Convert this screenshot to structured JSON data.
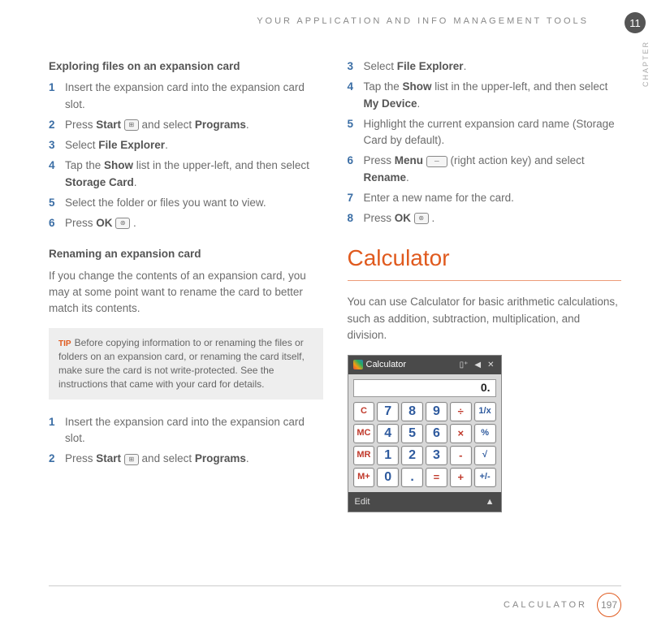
{
  "header": {
    "title": "YOUR APPLICATION AND INFO MANAGEMENT TOOLS",
    "chapter_number": "11",
    "chapter_label": "CHAPTER"
  },
  "left": {
    "sec1_title": "Exploring files on an expansion card",
    "s1": {
      "1": "Insert the expansion card into the expansion card slot.",
      "2a": "Press ",
      "2b": "Start",
      "2c": " and select ",
      "2d": "Programs",
      "2e": ".",
      "3a": "Select ",
      "3b": "File Explorer",
      "3c": ".",
      "4a": "Tap the ",
      "4b": "Show",
      "4c": " list in the upper-left, and then select ",
      "4d": "Storage Card",
      "4e": ".",
      "5": "Select the folder or files you want to view.",
      "6a": "Press ",
      "6b": "OK",
      "6c": " ."
    },
    "sec2_title": "Renaming an expansion card",
    "sec2_para": "If you change the contents of an expansion card, you may at some point want to rename the card to better match its contents.",
    "tip_label": "TIP",
    "tip_text": "Before copying information to or renaming the files or folders on an expansion card, or renaming the card itself, make sure the card is not write-protected. See the instructions that came with your card for details.",
    "s2": {
      "1": "Insert the expansion card into the expansion card slot.",
      "2a": "Press ",
      "2b": "Start",
      "2c": " and select ",
      "2d": "Programs",
      "2e": "."
    }
  },
  "right": {
    "s": {
      "3a": "Select ",
      "3b": "File Explorer",
      "3c": ".",
      "4a": "Tap the ",
      "4b": "Show",
      "4c": " list in the upper-left, and then select ",
      "4d": "My Device",
      "4e": ".",
      "5": "Highlight the current expansion card name (Storage Card by default).",
      "6a": "Press ",
      "6b": "Menu",
      "6c": " (right action key) and select ",
      "6d": "Rename",
      "6e": ".",
      "7": "Enter a new name for the card.",
      "8a": "Press ",
      "8b": "OK",
      "8c": " ."
    },
    "calc_title": "Calculator",
    "calc_para": "You can use Calculator for basic arithmetic calculations, such as addition, subtraction, multiplication, and division.",
    "window": {
      "title": "Calculator",
      "display": "0.",
      "keys": [
        [
          "C",
          "7",
          "8",
          "9",
          "÷",
          "1/x"
        ],
        [
          "MC",
          "4",
          "5",
          "6",
          "×",
          "%"
        ],
        [
          "MR",
          "1",
          "2",
          "3",
          "-",
          "√"
        ],
        [
          "M+",
          "0",
          ".",
          "=",
          "+",
          "+/-"
        ]
      ],
      "bottom_left": "Edit",
      "bottom_right": "▲"
    }
  },
  "footer": {
    "section": "CALCULATOR",
    "page": "197"
  }
}
